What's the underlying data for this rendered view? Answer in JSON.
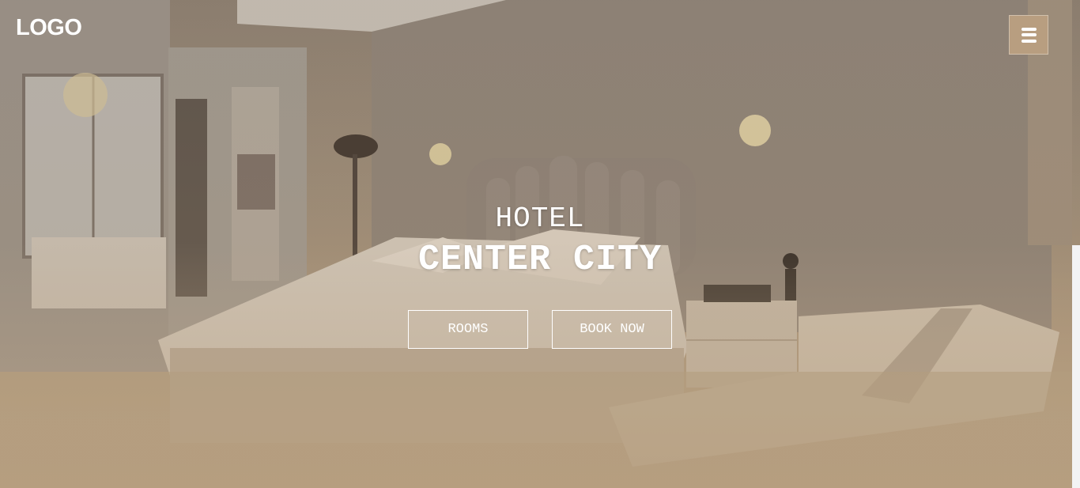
{
  "header": {
    "logo_text": "LOGO",
    "menu_icon": "hamburger-icon"
  },
  "hero": {
    "subtitle": "HOTEL",
    "title": "CENTER CITY",
    "buttons": [
      {
        "label": "ROOMS"
      },
      {
        "label": "BOOK NOW"
      }
    ]
  },
  "colors": {
    "accent": "#b89e80",
    "text": "#ffffff",
    "overlay_bottom": "#b69d7f"
  }
}
